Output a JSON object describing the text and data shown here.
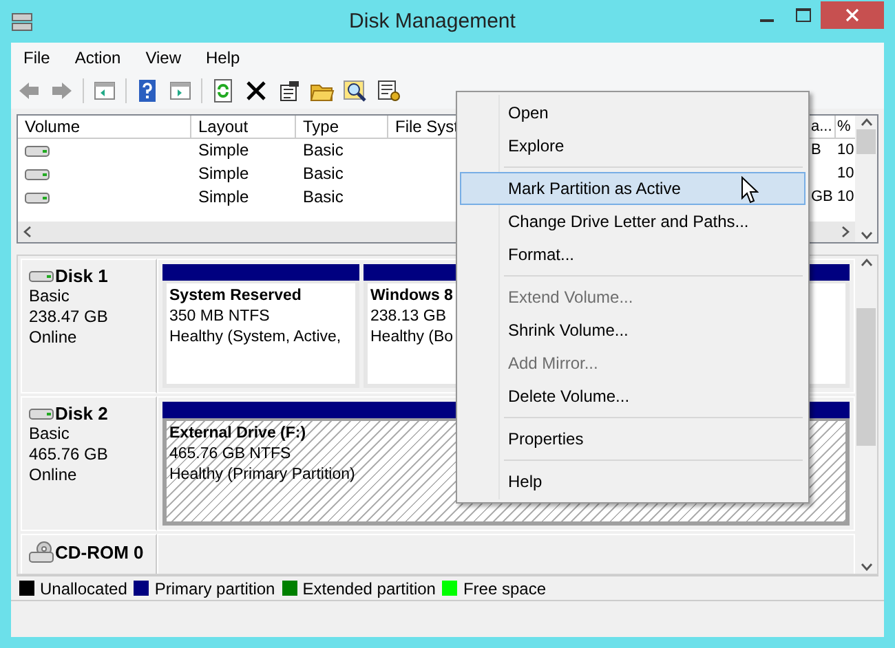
{
  "window": {
    "title": "Disk Management"
  },
  "menu_bar": [
    "File",
    "Action",
    "View",
    "Help"
  ],
  "volume_list": {
    "columns": [
      "Volume",
      "Layout",
      "Type",
      "File Syst",
      "a...",
      "%"
    ],
    "rows": [
      {
        "layout": "Simple",
        "type": "Basic",
        "column_5": "B",
        "column_6": "10"
      },
      {
        "layout": "Simple",
        "type": "Basic",
        "column_6": "10"
      },
      {
        "layout": "Simple",
        "type": "Basic",
        "column_5": "GB",
        "column_6": "10"
      }
    ]
  },
  "disks": [
    {
      "kind": "disk",
      "name": "Disk 1",
      "type": "Basic",
      "size": "238.47 GB",
      "status": "Online",
      "partitions": [
        {
          "name": "System Reserved",
          "size": "350 MB NTFS",
          "status": "Healthy (System, Active,",
          "selected": false
        },
        {
          "name": "Windows 8",
          "size": "238.13 GB",
          "status": "Healthy (Bo",
          "selected": false
        }
      ]
    },
    {
      "kind": "disk",
      "name": "Disk 2",
      "type": "Basic",
      "size": "465.76 GB",
      "status": "Online",
      "partitions": [
        {
          "name": "External Drive  (F:)",
          "size": "465.76 GB NTFS",
          "status": "Healthy (Primary Partition)",
          "selected": true
        }
      ]
    },
    {
      "kind": "cdrom",
      "name": "CD-ROM 0"
    }
  ],
  "legend": [
    {
      "label": "Unallocated",
      "color": "#000000"
    },
    {
      "label": "Primary partition",
      "color": "#000080"
    },
    {
      "label": "Extended partition",
      "color": "#008000"
    },
    {
      "label": "Free space",
      "color": "#00ff00"
    }
  ],
  "context_menu": [
    {
      "kind": "item",
      "label": "Open",
      "disabled": false,
      "selected": false
    },
    {
      "kind": "item",
      "label": "Explore",
      "disabled": false,
      "selected": false
    },
    {
      "kind": "separator"
    },
    {
      "kind": "item",
      "label": "Mark Partition as Active",
      "disabled": false,
      "selected": true
    },
    {
      "kind": "item",
      "label": "Change Drive Letter and Paths...",
      "disabled": false,
      "selected": false
    },
    {
      "kind": "item",
      "label": "Format...",
      "disabled": false,
      "selected": false
    },
    {
      "kind": "separator"
    },
    {
      "kind": "item",
      "label": "Extend Volume...",
      "disabled": true,
      "selected": false
    },
    {
      "kind": "item",
      "label": "Shrink Volume...",
      "disabled": false,
      "selected": false
    },
    {
      "kind": "item",
      "label": "Add Mirror...",
      "disabled": true,
      "selected": false
    },
    {
      "kind": "item",
      "label": "Delete Volume...",
      "disabled": false,
      "selected": false
    },
    {
      "kind": "separator"
    },
    {
      "kind": "item",
      "label": "Properties",
      "disabled": false,
      "selected": false
    },
    {
      "kind": "separator"
    },
    {
      "kind": "item",
      "label": "Help",
      "disabled": false,
      "selected": false
    }
  ]
}
